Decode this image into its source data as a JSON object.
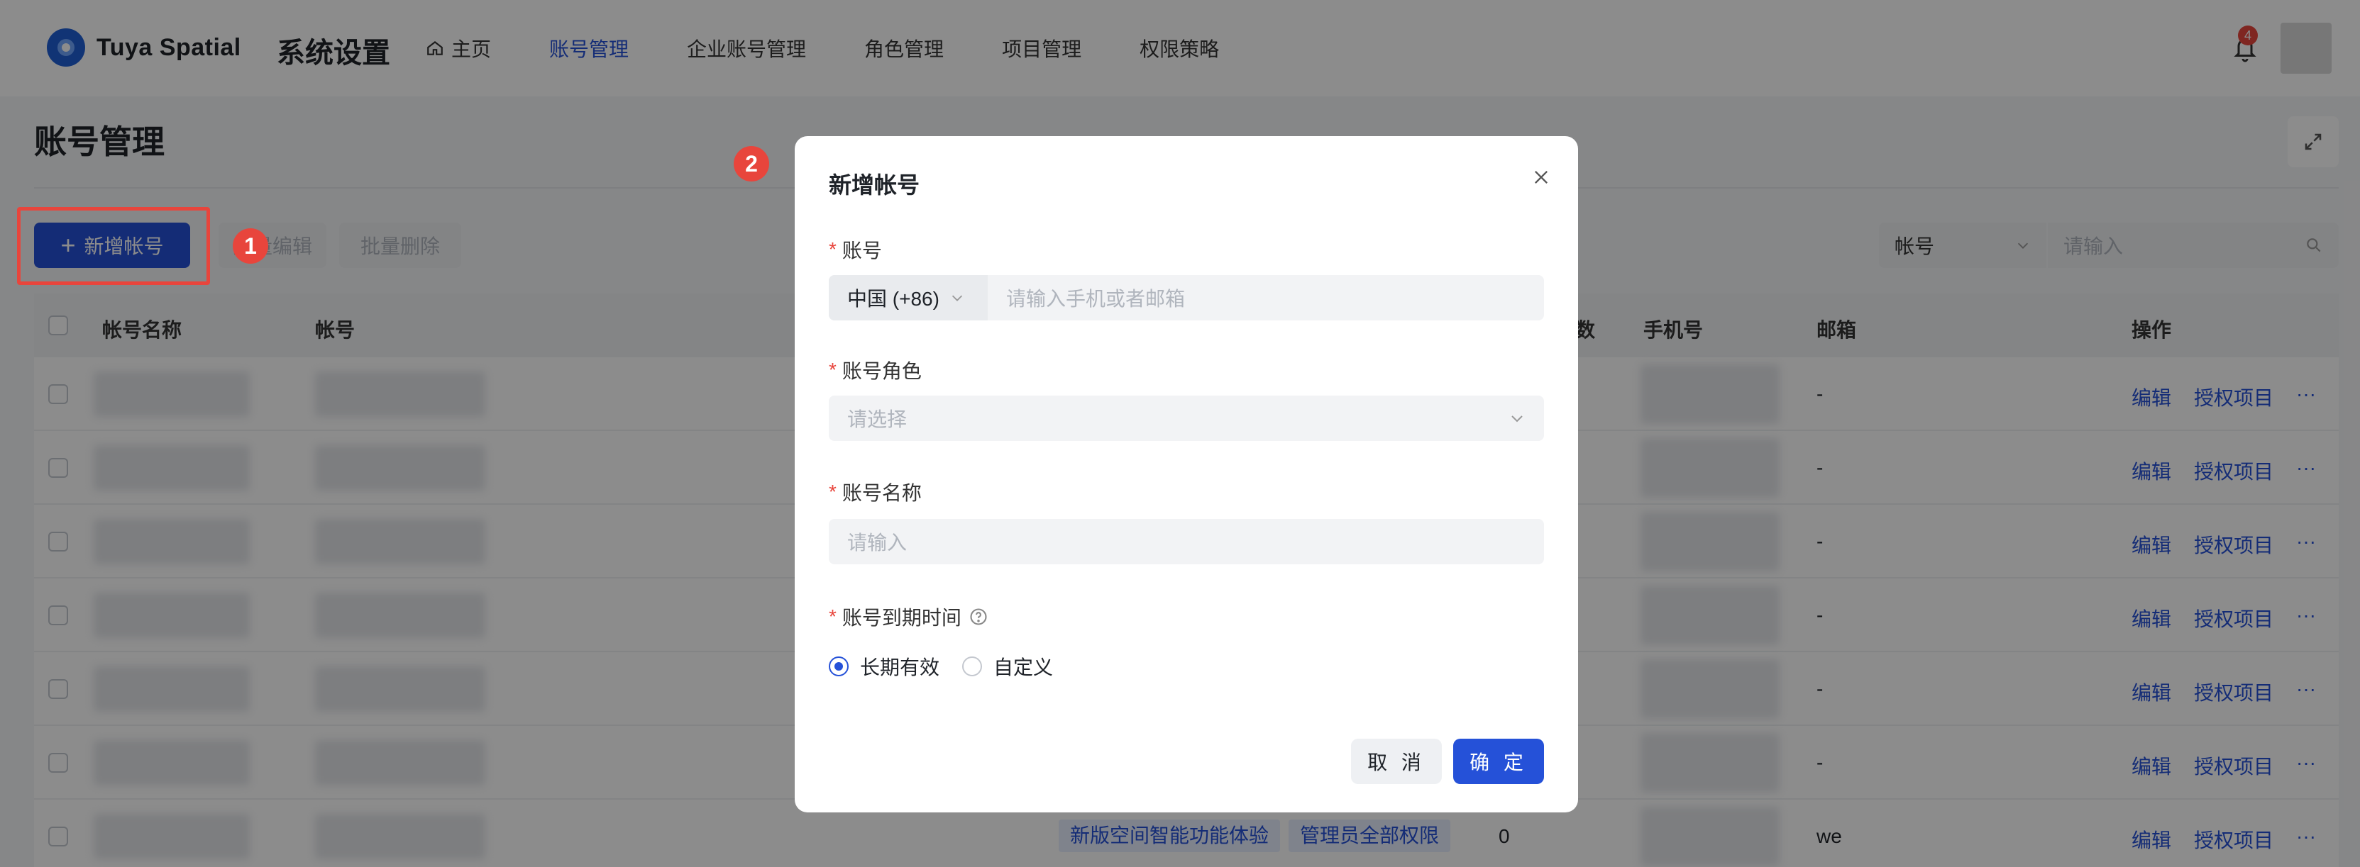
{
  "brand": {
    "name": "Tuya Spatial"
  },
  "app_title": "系统设置",
  "nav": [
    {
      "label": "主页",
      "icon": "home-icon"
    },
    {
      "label": "账号管理",
      "active": true
    },
    {
      "label": "企业账号管理"
    },
    {
      "label": "角色管理"
    },
    {
      "label": "项目管理"
    },
    {
      "label": "权限策略"
    }
  ],
  "notifications": {
    "count": "4"
  },
  "page": {
    "title": "账号管理"
  },
  "toolbar": {
    "add_label": "新增帐号",
    "batch_edit_label": "批量编辑",
    "batch_delete_label": "批量删除",
    "filter_select_value": "帐号",
    "filter_input_placeholder": "请输入"
  },
  "annotations": [
    "1",
    "2"
  ],
  "table": {
    "columns": [
      "帐号名称",
      "帐号",
      "数",
      "手机号",
      "邮箱",
      "操作"
    ],
    "rows": [
      {
        "email": "-",
        "edit": "编辑",
        "grant": "授权项目",
        "more": "···"
      },
      {
        "email": "-",
        "edit": "编辑",
        "grant": "授权项目",
        "more": "···"
      },
      {
        "email": "-",
        "edit": "编辑",
        "grant": "授权项目",
        "more": "···"
      },
      {
        "email": "-",
        "edit": "编辑",
        "grant": "授权项目",
        "more": "···"
      },
      {
        "email": "-",
        "edit": "编辑",
        "grant": "授权项目",
        "more": "···"
      },
      {
        "email": "-",
        "edit": "编辑",
        "grant": "授权项目",
        "more": "···"
      },
      {
        "email": "we",
        "count": "0",
        "tags": [
          "新版空间智能功能体验",
          "管理员全部权限"
        ],
        "edit": "编辑",
        "grant": "授权项目",
        "more": "···"
      }
    ]
  },
  "modal": {
    "title": "新增帐号",
    "account": {
      "label": "账号",
      "country": "中国 (+86)",
      "placeholder": "请输入手机或者邮箱"
    },
    "role": {
      "label": "账号角色",
      "placeholder": "请选择"
    },
    "name": {
      "label": "账号名称",
      "placeholder": "请输入"
    },
    "expiry": {
      "label": "账号到期时间",
      "options": [
        "长期有效",
        "自定义"
      ],
      "selected": "长期有效"
    },
    "cancel_label": "取 消",
    "ok_label": "确 定"
  },
  "colors": {
    "primary": "#2551d8",
    "danger": "#e8453c"
  }
}
